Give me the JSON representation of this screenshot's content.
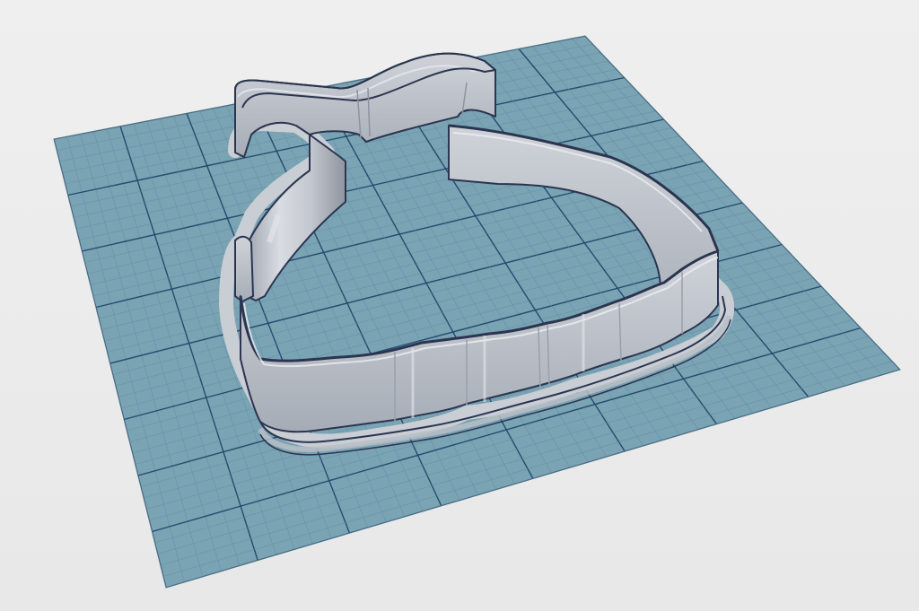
{
  "scene": {
    "background_color": "#ececec",
    "grid_plane_color": "#7aa3b4",
    "grid_minor_line_color": "#5e8fa3",
    "grid_major_line_color": "#24466a",
    "grid_major_every": 5,
    "model_wall_color": "#b8bdc6",
    "model_wall_highlight": "#dfe2e7",
    "model_wall_shadow": "#8b929d",
    "model_edge_color": "#2b3550",
    "model_object": "cookie-cutter",
    "model_icon": "cookie-cutter-icon"
  }
}
